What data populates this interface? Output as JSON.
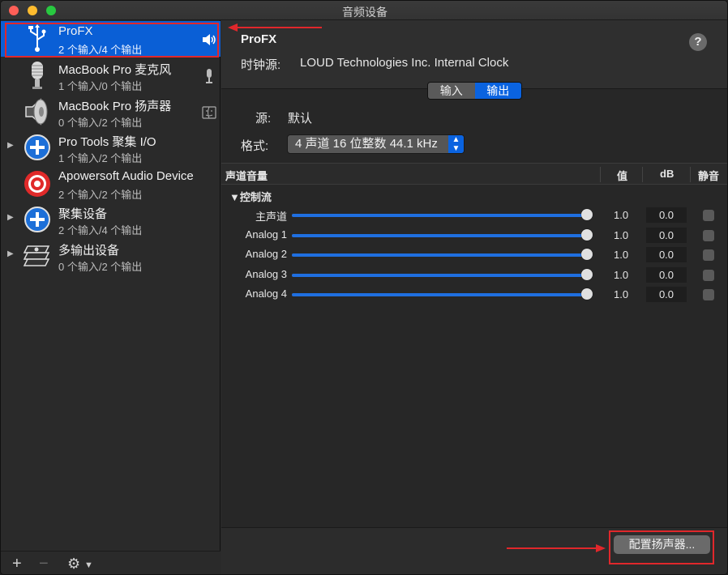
{
  "window": {
    "title": "音频设备"
  },
  "sidebar": {
    "devices": [
      {
        "name": "ProFX",
        "io": "2 个输入/4 个输出",
        "icon": "usb-icon",
        "selected": true,
        "disclosure": false,
        "right_icon": "speaker-volume-icon"
      },
      {
        "name": "MacBook Pro 麦克风",
        "io": "1 个输入/0 个输出",
        "icon": "microphone-icon",
        "selected": false,
        "disclosure": false,
        "right_icon": "microphone-small-icon"
      },
      {
        "name": "MacBook Pro 扬声器",
        "io": "0 个输入/2 个输出",
        "icon": "speaker-icon",
        "selected": false,
        "disclosure": false,
        "right_icon": "finder-icon"
      },
      {
        "name": "Pro Tools 聚集 I/O",
        "io": "1 个输入/2 个输出",
        "icon": "aggregate-plus-icon",
        "selected": false,
        "disclosure": true
      },
      {
        "name": "Apowersoft Audio Device",
        "io": "2 个输入/2 个输出",
        "icon": "target-icon",
        "selected": false,
        "disclosure": false
      },
      {
        "name": "聚集设备",
        "io": "2 个输入/4 个输出",
        "icon": "aggregate-plus-icon",
        "selected": false,
        "disclosure": true
      },
      {
        "name": "多输出设备",
        "io": "0 个输入/2 个输出",
        "icon": "multi-output-icon",
        "selected": false,
        "disclosure": true
      }
    ],
    "bottom": {
      "add": "+",
      "remove": "−",
      "gear": "⚙"
    }
  },
  "detail": {
    "title": "ProFX",
    "clock_label": "时钟源:",
    "clock_value": "LOUD Technologies Inc. Internal Clock",
    "help": "?",
    "tabs": {
      "input": "输入",
      "output": "输出",
      "active": "output"
    },
    "source_label": "源:",
    "source_value": "默认",
    "format_label": "格式:",
    "format_value": "4 声道 16 位整数 44.1 kHz",
    "table": {
      "col_channel_volume": "声道音量",
      "col_value": "值",
      "col_db": "dB",
      "col_mute": "静音",
      "group": "▼控制流",
      "channels": [
        {
          "name": "主声道",
          "value": "1.0",
          "db": "0.0",
          "level": 1.0
        },
        {
          "name": "Analog 1",
          "value": "1.0",
          "db": "0.0",
          "level": 1.0
        },
        {
          "name": "Analog 2",
          "value": "1.0",
          "db": "0.0",
          "level": 1.0
        },
        {
          "name": "Analog 3",
          "value": "1.0",
          "db": "0.0",
          "level": 1.0
        },
        {
          "name": "Analog 4",
          "value": "1.0",
          "db": "0.0",
          "level": 1.0
        }
      ]
    },
    "configure_button": "配置扬声器..."
  },
  "colors": {
    "accent": "#0a63e0",
    "annotation": "#e0272b"
  }
}
